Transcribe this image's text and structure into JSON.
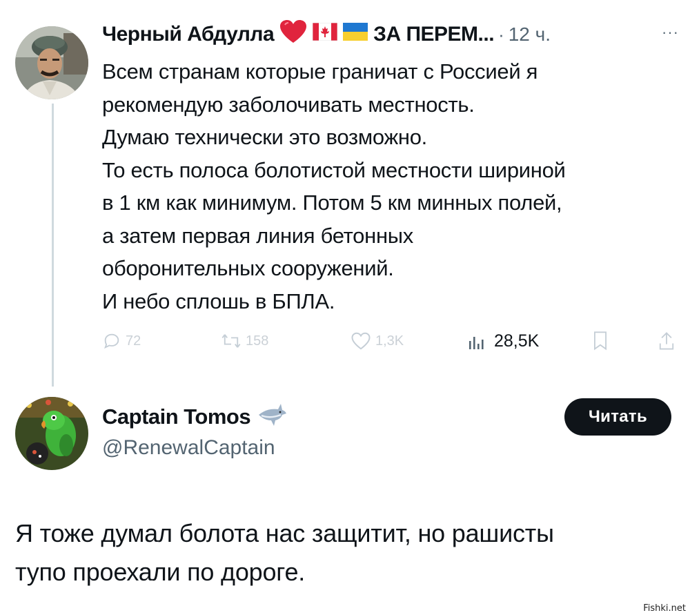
{
  "tweet1": {
    "author_name": "Черный Абдулла",
    "name_suffix": "ЗА ПЕРЕМ...",
    "emojis": [
      "red-heart-emoji",
      "canada-flag-emoji",
      "ukraine-flag-emoji"
    ],
    "separator": "·",
    "timestamp": "12 ч.",
    "more_label": "···",
    "body_lines": [
      "Всем странам которые граничат с Россией я",
      "рекомендую заболочивать местность.",
      "Думаю технически это возможно.",
      "То есть полоса болотистой местности шириной",
      "в 1 км как минимум. Потом 5 км минных полей,",
      "а затем первая линия бетонных",
      "оборонительных сооружений.",
      "И небо сплошь в БПЛА."
    ],
    "actions": {
      "replies": "72",
      "retweets": "158",
      "likes": "1,3K",
      "views": "28,5K"
    }
  },
  "tweet2": {
    "author_name": "Captain Tomos",
    "badge_emoji": "shark-emoji",
    "handle": "@RenewalCaptain",
    "follow_label": "Читать",
    "body_lines": [
      "Я тоже думал болота нас защитит, но рашисты",
      "тупо проехали по дороге."
    ]
  },
  "watermark": "Fishki.net",
  "colors": {
    "text_primary": "#0f1419",
    "text_secondary": "#536471",
    "thread_line": "#cfd9de",
    "button_bg": "#0f1419",
    "button_text": "#ffffff"
  }
}
